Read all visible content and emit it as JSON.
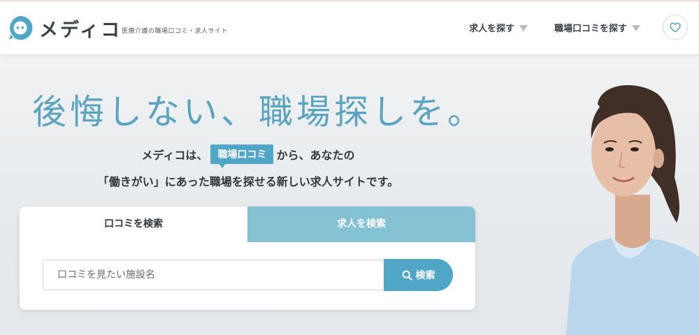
{
  "brand": {
    "name": "メディコ",
    "tagline": "医療介護の職場口コミ・求人サイト",
    "color": "#4fa6c6"
  },
  "nav": {
    "items": [
      {
        "label": "求人を探す",
        "icon": "triangle-down-icon"
      },
      {
        "label": "職場口コミを探す",
        "icon": "triangle-down-icon"
      }
    ],
    "favorite_icon": "heart-icon"
  },
  "hero": {
    "headline": "後悔しない、職場探しを。",
    "intro_pre": "メディコは、",
    "intro_badge": "職場口コミ",
    "intro_post": "から、あなたの",
    "intro_line2": "「働きがい」にあった職場を探せる新しい求人サイトです。"
  },
  "search": {
    "tabs": [
      {
        "label": "口コミを検索",
        "active": true
      },
      {
        "label": "求人を検索",
        "active": false
      }
    ],
    "placeholder": "口コミを見たい施設名",
    "value": "",
    "button_label": "検索",
    "button_icon": "search-icon"
  },
  "colors": {
    "accent": "#4fa6c6",
    "tab_inactive": "#84c1d3",
    "headline": "#5aa4c0",
    "text": "#30373c"
  }
}
